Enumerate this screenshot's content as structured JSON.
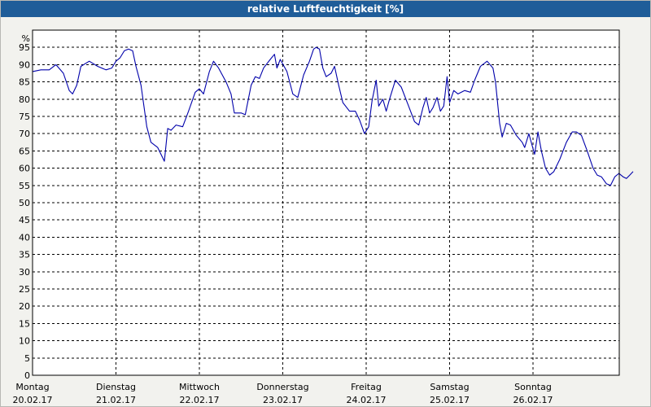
{
  "header": {
    "title": "relative Luftfeuchtigkeit [%]"
  },
  "colors": {
    "title_bar": "#1f5d99",
    "series_line": "#0000aa",
    "grid": "#000000",
    "background": "#f2f2ee"
  },
  "chart_data": {
    "type": "line",
    "title": "relative Luftfeuchtigkeit [%]",
    "ylabel": "%",
    "xlabel": "",
    "ylim": [
      0,
      100
    ],
    "y_ticks": [
      0,
      5,
      10,
      15,
      20,
      25,
      30,
      35,
      40,
      45,
      50,
      55,
      60,
      65,
      70,
      75,
      80,
      85,
      90,
      95
    ],
    "grid": true,
    "legend": "none",
    "xlim": [
      0,
      7
    ],
    "x_unit": "days",
    "x_ticks": [
      {
        "day": "Montag",
        "date": "20.02.17"
      },
      {
        "day": "Dienstag",
        "date": "21.02.17"
      },
      {
        "day": "Mittwoch",
        "date": "22.02.17"
      },
      {
        "day": "Donnerstag",
        "date": "23.02.17"
      },
      {
        "day": "Freitag",
        "date": "24.02.17"
      },
      {
        "day": "Samstag",
        "date": "25.02.17"
      },
      {
        "day": "Sonntag",
        "date": "26.02.17"
      }
    ],
    "series": [
      {
        "points": [
          [
            0.0,
            88.0
          ],
          [
            0.1,
            88.5
          ],
          [
            0.2,
            88.5
          ],
          [
            0.28,
            90.0
          ],
          [
            0.37,
            87.5
          ],
          [
            0.44,
            82.5
          ],
          [
            0.48,
            81.5
          ],
          [
            0.53,
            84.0
          ],
          [
            0.58,
            89.5
          ],
          [
            0.68,
            91.0
          ],
          [
            0.78,
            89.5
          ],
          [
            0.88,
            88.5
          ],
          [
            0.95,
            89.0
          ],
          [
            1.0,
            91.0
          ],
          [
            1.05,
            92.0
          ],
          [
            1.1,
            94.0
          ],
          [
            1.15,
            94.5
          ],
          [
            1.2,
            94.0
          ],
          [
            1.24,
            89.5
          ],
          [
            1.3,
            84.0
          ],
          [
            1.37,
            72.0
          ],
          [
            1.42,
            67.5
          ],
          [
            1.5,
            66.0
          ],
          [
            1.58,
            62.0
          ],
          [
            1.62,
            71.5
          ],
          [
            1.66,
            71.0
          ],
          [
            1.72,
            72.5
          ],
          [
            1.8,
            72.0
          ],
          [
            1.87,
            76.5
          ],
          [
            1.95,
            82.0
          ],
          [
            2.0,
            83.0
          ],
          [
            2.05,
            81.5
          ],
          [
            2.12,
            88.0
          ],
          [
            2.17,
            91.0
          ],
          [
            2.23,
            89.0
          ],
          [
            2.32,
            85.0
          ],
          [
            2.38,
            81.5
          ],
          [
            2.42,
            76.0
          ],
          [
            2.5,
            76.0
          ],
          [
            2.55,
            75.5
          ],
          [
            2.62,
            84.0
          ],
          [
            2.67,
            86.5
          ],
          [
            2.72,
            86.0
          ],
          [
            2.77,
            89.0
          ],
          [
            2.85,
            91.5
          ],
          [
            2.9,
            93.0
          ],
          [
            2.93,
            89.0
          ],
          [
            2.97,
            91.5
          ],
          [
            3.05,
            88.0
          ],
          [
            3.12,
            81.5
          ],
          [
            3.18,
            80.5
          ],
          [
            3.25,
            87.0
          ],
          [
            3.32,
            91.0
          ],
          [
            3.37,
            94.5
          ],
          [
            3.4,
            95.0
          ],
          [
            3.44,
            94.5
          ],
          [
            3.48,
            89.0
          ],
          [
            3.52,
            86.5
          ],
          [
            3.58,
            87.5
          ],
          [
            3.62,
            89.5
          ],
          [
            3.67,
            84.0
          ],
          [
            3.72,
            79.0
          ],
          [
            3.8,
            76.5
          ],
          [
            3.87,
            76.5
          ],
          [
            3.92,
            74.0
          ],
          [
            3.98,
            70.0
          ],
          [
            4.03,
            72.0
          ],
          [
            4.07,
            79.5
          ],
          [
            4.12,
            85.5
          ],
          [
            4.15,
            78.0
          ],
          [
            4.2,
            80.0
          ],
          [
            4.24,
            76.5
          ],
          [
            4.28,
            80.0
          ],
          [
            4.35,
            85.5
          ],
          [
            4.42,
            83.5
          ],
          [
            4.5,
            78.5
          ],
          [
            4.58,
            73.5
          ],
          [
            4.63,
            72.5
          ],
          [
            4.68,
            77.5
          ],
          [
            4.72,
            80.5
          ],
          [
            4.76,
            76.0
          ],
          [
            4.8,
            77.5
          ],
          [
            4.85,
            80.5
          ],
          [
            4.89,
            76.5
          ],
          [
            4.93,
            78.0
          ],
          [
            4.97,
            86.5
          ],
          [
            5.0,
            79.0
          ],
          [
            5.05,
            82.5
          ],
          [
            5.1,
            81.5
          ],
          [
            5.18,
            82.5
          ],
          [
            5.25,
            82.0
          ],
          [
            5.3,
            85.5
          ],
          [
            5.37,
            89.5
          ],
          [
            5.45,
            91.0
          ],
          [
            5.52,
            89.0
          ],
          [
            5.55,
            85.0
          ],
          [
            5.6,
            73.0
          ],
          [
            5.63,
            69.0
          ],
          [
            5.68,
            73.0
          ],
          [
            5.73,
            72.5
          ],
          [
            5.8,
            69.5
          ],
          [
            5.87,
            67.5
          ],
          [
            5.9,
            66.0
          ],
          [
            5.95,
            70.0
          ],
          [
            5.99,
            66.5
          ],
          [
            6.02,
            64.0
          ],
          [
            6.06,
            70.5
          ],
          [
            6.1,
            65.0
          ],
          [
            6.15,
            60.0
          ],
          [
            6.2,
            58.0
          ],
          [
            6.25,
            59.0
          ],
          [
            6.32,
            62.5
          ],
          [
            6.4,
            67.5
          ],
          [
            6.47,
            70.5
          ],
          [
            6.52,
            70.5
          ],
          [
            6.58,
            69.5
          ],
          [
            6.65,
            65.0
          ],
          [
            6.72,
            60.0
          ],
          [
            6.77,
            58.0
          ],
          [
            6.82,
            57.5
          ],
          [
            6.88,
            55.5
          ],
          [
            6.93,
            55.0
          ],
          [
            6.98,
            57.5
          ],
          [
            7.03,
            58.5
          ],
          [
            7.08,
            57.5
          ],
          [
            7.12,
            57.0
          ],
          [
            7.16,
            58.0
          ],
          [
            7.2,
            59.0
          ]
        ]
      }
    ]
  }
}
